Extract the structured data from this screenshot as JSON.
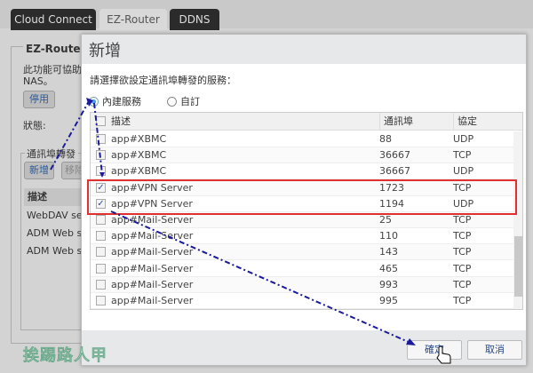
{
  "tabs": [
    {
      "label": "Cloud Connect"
    },
    {
      "label": "EZ-Router"
    },
    {
      "label": "DDNS"
    }
  ],
  "background": {
    "section_title": "EZ-Router 設定",
    "description": "此功能可協助您設定路由器",
    "description2": "NAS。",
    "disable_button": "停用",
    "status_label": "狀態:",
    "port_forward_title": "通訊埠轉發",
    "add_button": "新增",
    "remove_button": "移除",
    "table_header": "描述",
    "rows": [
      "WebDAV server",
      "ADM Web server",
      "ADM Web server"
    ]
  },
  "dialog": {
    "title": "新增",
    "instruction": "請選擇欲設定通訊埠轉發的服務：",
    "radio_builtin": "內建服務",
    "radio_custom": "自訂",
    "columns": {
      "description": "描述",
      "port": "通訊埠",
      "protocol": "協定"
    },
    "rows": [
      {
        "desc": "app#XBMC",
        "port": "88",
        "proto": "UDP",
        "checked": false
      },
      {
        "desc": "app#XBMC",
        "port": "36667",
        "proto": "TCP",
        "checked": false
      },
      {
        "desc": "app#XBMC",
        "port": "36667",
        "proto": "UDP",
        "checked": false
      },
      {
        "desc": "app#VPN Server",
        "port": "1723",
        "proto": "TCP",
        "checked": true
      },
      {
        "desc": "app#VPN Server",
        "port": "1194",
        "proto": "UDP",
        "checked": true
      },
      {
        "desc": "app#Mail-Server",
        "port": "25",
        "proto": "TCP",
        "checked": false
      },
      {
        "desc": "app#Mail-Server",
        "port": "110",
        "proto": "TCP",
        "checked": false
      },
      {
        "desc": "app#Mail-Server",
        "port": "143",
        "proto": "TCP",
        "checked": false
      },
      {
        "desc": "app#Mail-Server",
        "port": "465",
        "proto": "TCP",
        "checked": false
      },
      {
        "desc": "app#Mail-Server",
        "port": "993",
        "proto": "TCP",
        "checked": false
      },
      {
        "desc": "app#Mail-Server",
        "port": "995",
        "proto": "TCP",
        "checked": false
      }
    ],
    "ok_button": "確定",
    "cancel_button": "取消"
  },
  "watermark": "挨踢路人甲",
  "colors": {
    "highlight": "#e03030",
    "arrow": "#1a1a9a"
  }
}
